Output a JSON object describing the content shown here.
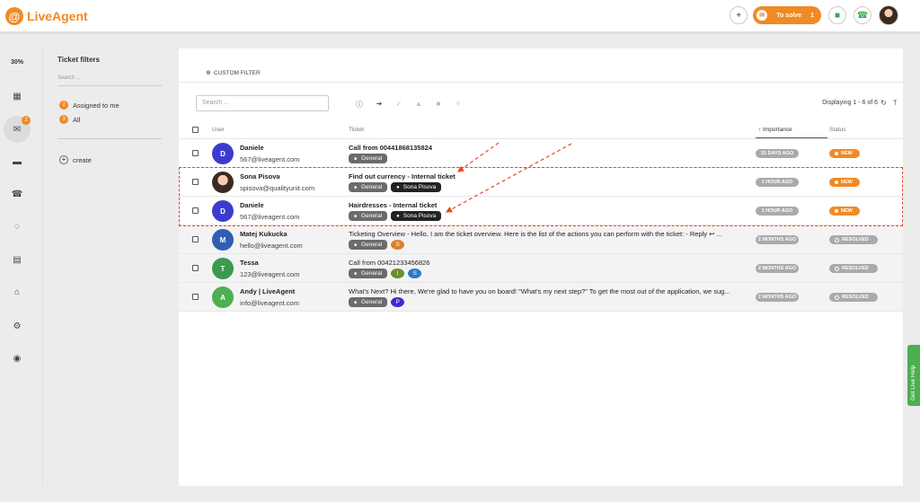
{
  "app": {
    "logo_mark": "@",
    "name": "LiveAgent"
  },
  "topbar": {
    "add_icon": "+",
    "to_solve_label": "To solve",
    "to_solve_count": "1",
    "chat_icon": "■",
    "phone_icon": "☎"
  },
  "nav": {
    "percent": "30%",
    "items": [
      {
        "name": "dashboard",
        "icon": "▦"
      },
      {
        "name": "tickets",
        "icon": "✉",
        "badge": "2"
      },
      {
        "name": "chats",
        "icon": "▬"
      },
      {
        "name": "calls",
        "icon": "☎"
      },
      {
        "name": "reports",
        "icon": "◌"
      },
      {
        "name": "contacts",
        "icon": "▤"
      },
      {
        "name": "knowledgebase",
        "icon": "⌂"
      },
      {
        "name": "configuration",
        "icon": "⚙"
      },
      {
        "name": "plugins",
        "icon": "◉"
      }
    ]
  },
  "filters": {
    "title": "Ticket filters",
    "search_placeholder": "Search ...",
    "items": [
      {
        "count": "2",
        "label": "Assigned to me"
      },
      {
        "count": "3",
        "label": "All"
      }
    ],
    "create_label": "create"
  },
  "header": {
    "custom_filter_icon": "⊕",
    "custom_filter_label": "CUSTOM FILTER"
  },
  "list": {
    "search_placeholder": "Search ...",
    "toolbar": [
      {
        "name": "info",
        "icon": "ⓘ"
      },
      {
        "name": "forward",
        "icon": "➜"
      },
      {
        "name": "resolve",
        "icon": "✓"
      },
      {
        "name": "spam",
        "icon": "▲"
      },
      {
        "name": "delete",
        "icon": "■"
      },
      {
        "name": "magic",
        "icon": "✧"
      }
    ],
    "displaying": "Displaying 1 - 6 of 6",
    "refresh_icon": "↻",
    "collapse_icon": "⤒",
    "columns": {
      "user": "User",
      "ticket": "Ticket",
      "importance": "↑ Importance",
      "status": "Status"
    },
    "rows": [
      {
        "name": "Daniele",
        "email": "567@liveagent.com",
        "initial": "D",
        "avatar_color": "#3b3ccf",
        "subject": "Call from 00441868135824",
        "bold": true,
        "dept": "General",
        "agent": "",
        "extra_tags": [],
        "age": "31 DAYS AGO",
        "status": "NEW"
      },
      {
        "name": "Sona Pisova",
        "email": "spisova@qualityunit.com",
        "initial": "",
        "avatar_color": "photo",
        "subject": "Find out currency - Internal ticket",
        "bold": true,
        "dept": "General",
        "agent": "Sona Pisova",
        "extra_tags": [],
        "age": "1 HOUR AGO",
        "status": "NEW"
      },
      {
        "name": "Daniele",
        "email": "567@liveagent.com",
        "initial": "D",
        "avatar_color": "#3b3ccf",
        "subject": "Hairdresses - Internal ticket",
        "bold": true,
        "dept": "General",
        "agent": "Sona Pisova",
        "extra_tags": [],
        "age": "1 HOUR AGO",
        "status": "NEW"
      },
      {
        "name": "Matej Kukucka",
        "email": "hello@liveagent.com",
        "initial": "M",
        "avatar_color": "#2f5fb3",
        "subject": "Ticketing Overview - Hello, I am the ticket overview. Here is the list of the actions you can perform with the ticket: - Reply ↩ ...",
        "bold": false,
        "dept": "General",
        "agent": "",
        "extra_tags": [
          {
            "label": "S",
            "color": "#d9822b"
          }
        ],
        "age": "2 MONTHS AGO",
        "status": "RESOLVED"
      },
      {
        "name": "Tessa",
        "email": "123@liveagent.com",
        "initial": "T",
        "avatar_color": "#3c9a4f",
        "subject": "Call from 00421233456826",
        "bold": false,
        "dept": "General",
        "agent": "",
        "extra_tags": [
          {
            "label": "I",
            "color": "#6a8f2a"
          },
          {
            "label": "S",
            "color": "#2f78c8"
          }
        ],
        "age": "2 MONTHS AGO",
        "status": "RESOLVED"
      },
      {
        "name": "Andy | LiveAgent",
        "email": "info@liveagent.com",
        "initial": "A",
        "avatar_color": "#4caf50",
        "subject": "What's Next? Hi there, We're glad to have you on board! \"What's my next step?\" To get the most out of the application, we sug...",
        "bold": false,
        "dept": "General",
        "agent": "",
        "extra_tags": [
          {
            "label": "P",
            "color": "#3b2ccf"
          }
        ],
        "age": "2 MONTHS AGO",
        "status": "RESOLVED"
      }
    ]
  },
  "live_help": "Get Live Help",
  "colors": {
    "accent": "#f08a24",
    "annotation": "#e8472a"
  }
}
